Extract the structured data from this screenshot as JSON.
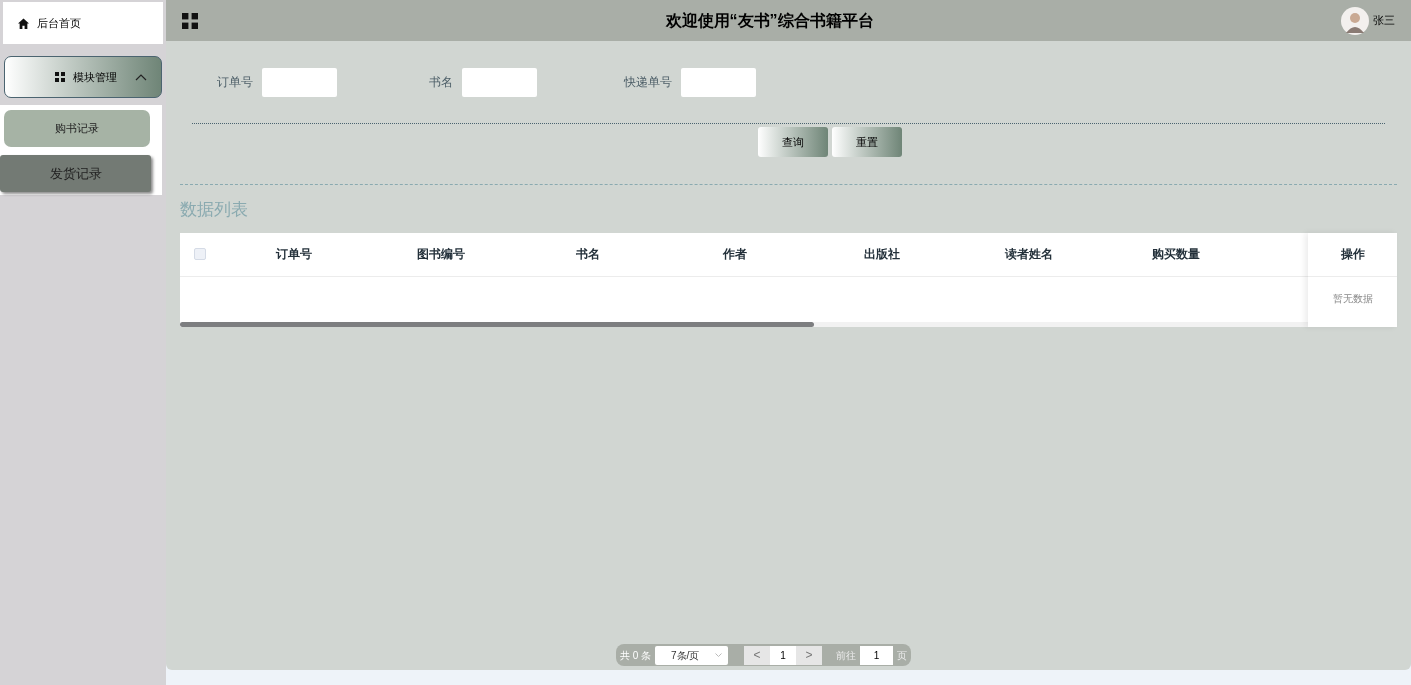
{
  "sidebar": {
    "home": "后台首页",
    "menu": {
      "label": "模块管理",
      "expanded": true,
      "items": [
        {
          "label": "购书记录",
          "selected": true
        },
        {
          "label": "发货记录",
          "selected": false
        }
      ]
    }
  },
  "header": {
    "title": "欢迎使用“友书”综合书籍平台",
    "user": "张三"
  },
  "search": {
    "fields": [
      {
        "label": "订单号"
      },
      {
        "label": "书名"
      },
      {
        "label": "快递单号"
      }
    ],
    "buttons": [
      "查询",
      "重置"
    ]
  },
  "list_title": "数据列表",
  "table": {
    "select_all": {
      "checked": false
    },
    "columns": [
      "订单号",
      "图书编号",
      "书名",
      "作者",
      "出版社",
      "读者姓名",
      "购买数量"
    ],
    "fixed_column": "操作",
    "empty_text": "暂无数据"
  },
  "pagination": {
    "total": "共 0 条",
    "page_size": "7条/页",
    "prev": "<",
    "page": "1",
    "next": ">",
    "goto_label": "前往",
    "goto_value": "1",
    "goto_suffix": "页"
  }
}
